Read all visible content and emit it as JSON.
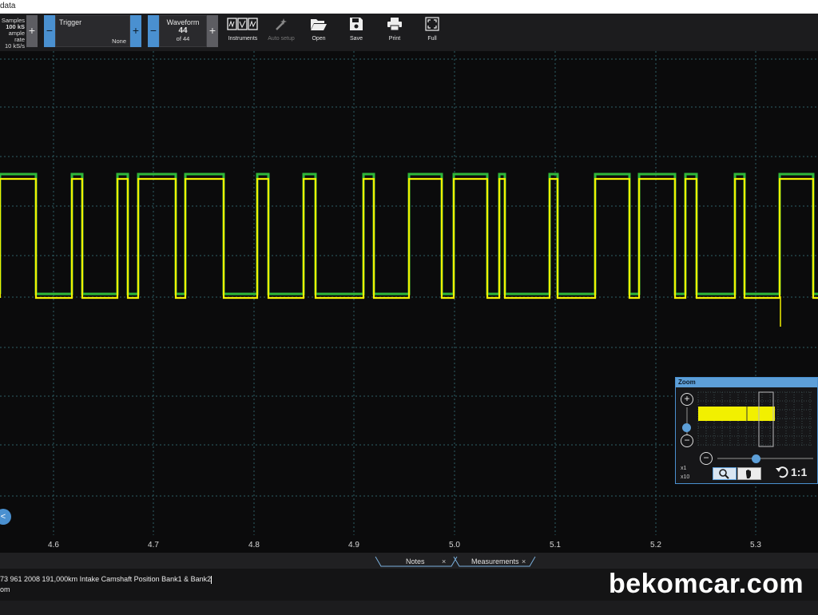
{
  "window": {
    "title": "data"
  },
  "toolbar": {
    "samples_label": "Samples",
    "samples_value": "100 kS",
    "sample_rate_label": "ample rate",
    "sample_rate_value": "10 kS/s",
    "plus": "+",
    "minus": "−",
    "trigger_label": "Trigger",
    "trigger_value": "None",
    "waveform_label": "Waveform",
    "waveform_value": "44",
    "waveform_of": "of 44",
    "buttons": {
      "instruments": "Instruments",
      "auto_setup": "Auto setup",
      "open": "Open",
      "save": "Save",
      "print": "Print",
      "full": "Full"
    }
  },
  "plot": {
    "x_ticks": [
      "4.6",
      "4.7",
      "4.8",
      "4.9",
      "5.0",
      "5.1",
      "5.2",
      "5.3"
    ],
    "colors": {
      "background": "#0b0b0c",
      "grid": "#2e5f66",
      "trace_yellow": "#f2f000",
      "trace_green": "#2fb83a"
    },
    "trace_high_level": 1,
    "trace_low_level": 0
  },
  "zoom": {
    "title": "Zoom",
    "plus": "+",
    "minus": "−",
    "x1": "x1",
    "x10": "x10",
    "one_to_one": "1:1",
    "slider_value": 0.4
  },
  "nav": {
    "arrow": "<"
  },
  "bottom": {
    "tabs": [
      {
        "label": "Notes",
        "close": "×"
      },
      {
        "label": "Measurements",
        "close": "×"
      }
    ],
    "notes_line1": "73 961 2008 191,000km Intake Camshaft Position Bank1 & Bank2",
    "notes_line2": "om"
  },
  "watermark": "bekomcar.com"
}
